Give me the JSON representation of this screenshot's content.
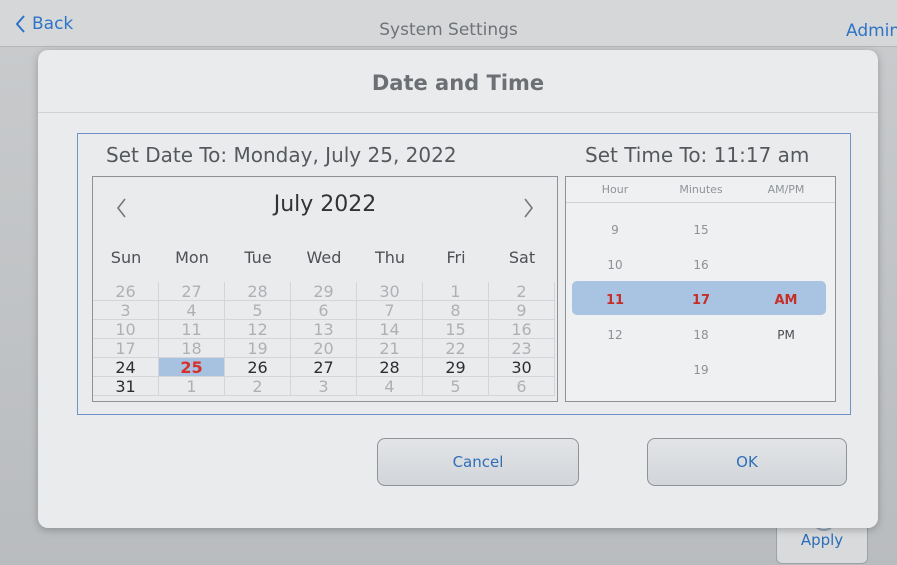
{
  "topbar": {
    "back_label": "Back",
    "title": "System Settings",
    "user": "Admin"
  },
  "apply_label": "Apply",
  "dialog": {
    "title": "Date and Time",
    "date_heading": "Set Date To: Monday, July 25, 2022",
    "time_heading": "Set Time To: 11:17 am",
    "cancel_label": "Cancel",
    "ok_label": "OK"
  },
  "calendar": {
    "month_label": "July 2022",
    "prev_icon": "chevron-left-icon",
    "next_icon": "chevron-right-icon",
    "weekdays": [
      "Sun",
      "Mon",
      "Tue",
      "Wed",
      "Thu",
      "Fri",
      "Sat"
    ],
    "weeks": [
      [
        "26",
        "27",
        "28",
        "29",
        "30",
        "1",
        "2"
      ],
      [
        "3",
        "4",
        "5",
        "6",
        "7",
        "8",
        "9"
      ],
      [
        "10",
        "11",
        "12",
        "13",
        "14",
        "15",
        "16"
      ],
      [
        "17",
        "18",
        "19",
        "20",
        "21",
        "22",
        "23"
      ],
      [
        "24",
        "25",
        "26",
        "27",
        "28",
        "29",
        "30"
      ],
      [
        "31",
        "1",
        "2",
        "3",
        "4",
        "5",
        "6"
      ]
    ],
    "selected_day": "25"
  },
  "time_picker": {
    "headers": [
      "Hour",
      "Minutes",
      "AM/PM"
    ],
    "hours": [
      "9",
      "10",
      "11",
      "12"
    ],
    "minutes": [
      "15",
      "16",
      "17",
      "18",
      "19"
    ],
    "ampm": [
      "AM",
      "PM"
    ],
    "selected": {
      "hour": "11",
      "minute": "17",
      "ampm": "AM"
    }
  },
  "colors": {
    "accent": "#2d74c6",
    "selected_bg": "#a7c2e1",
    "selected_text": "#d6302c"
  }
}
